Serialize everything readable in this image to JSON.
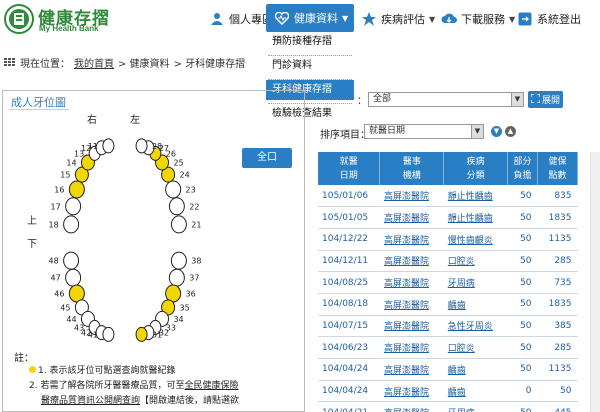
{
  "site": {
    "title": "健康存摺",
    "subtitle": "My Health Bank",
    "logo_ring_text": "衛生福利部中央健康保險署",
    "brand_color": "#2f8a3a"
  },
  "nav": {
    "personal": "個人專區",
    "health": "健康資料",
    "disease": "疾病評估",
    "download": "下載服務",
    "logout": "系統登出"
  },
  "dropdown": {
    "items": [
      {
        "label": "預防接種存摺",
        "active": false
      },
      {
        "label": "門診資料",
        "active": false
      },
      {
        "label": "牙科健康存摺",
        "active": true
      },
      {
        "label": "檢驗檢查結果",
        "active": false
      }
    ]
  },
  "breadcrumb": {
    "prefix": "現在位置：",
    "home": "我的首頁",
    "sep1": "> 健康資料",
    "sep2": "> 牙科健康存摺"
  },
  "panel": {
    "title": "成人牙位圖",
    "right": "右",
    "left": "左",
    "upper": "上",
    "lower": "下",
    "all_button": "全口",
    "notes_label": "註：",
    "note1": "1. 表示該牙位可點選查詢就醫紀錄",
    "note2_prefix": "2. 若需了解各院所牙醫醫療品質，可至",
    "note2_link": "全民健康保險",
    "note3_link": "醫療品質資訊公開網查詢",
    "note3_suffix": "【開啟連結後，請點選欲",
    "highlight_color": "#f2d600"
  },
  "teeth": {
    "upper_right": [
      "18",
      "17",
      "16",
      "15",
      "14",
      "13",
      "12",
      "11"
    ],
    "upper_left": [
      "21",
      "22",
      "23",
      "24",
      "25",
      "26",
      "27",
      "28"
    ],
    "lower_left": [
      "38",
      "37",
      "36",
      "35",
      "34",
      "33",
      "32",
      "31"
    ],
    "lower_right": [
      "48",
      "47",
      "46",
      "45",
      "44",
      "43",
      "42",
      "41"
    ],
    "highlighted": [
      "16",
      "15",
      "14",
      "24",
      "25",
      "26",
      "46",
      "36",
      "35",
      "31"
    ]
  },
  "filter": {
    "colon": "：",
    "value": "全部",
    "expand_label": "展開"
  },
  "sort": {
    "label": "排序項目：",
    "value": "就醫日期"
  },
  "table": {
    "headers": [
      [
        "就醫",
        "日期"
      ],
      [
        "醫事",
        "機構"
      ],
      [
        "疾病",
        "分類"
      ],
      [
        "部分",
        "負擔"
      ],
      [
        "健保",
        "點數"
      ]
    ],
    "rows": [
      {
        "date": "105/01/06",
        "inst": "高屏澎醫院",
        "dx": "靜止性齲齒",
        "copay": "50",
        "points": "835"
      },
      {
        "date": "105/01/05",
        "inst": "高屏澎醫院",
        "dx": "靜止性齲齒",
        "copay": "50",
        "points": "1835"
      },
      {
        "date": "104/12/22",
        "inst": "高屏澎醫院",
        "dx": "慢性齒齦炎",
        "copay": "50",
        "points": "1135"
      },
      {
        "date": "104/12/11",
        "inst": "高屏澎醫院",
        "dx": "口腔炎",
        "copay": "50",
        "points": "285"
      },
      {
        "date": "104/08/25",
        "inst": "高屏澎醫院",
        "dx": "牙周病",
        "copay": "50",
        "points": "735"
      },
      {
        "date": "104/08/18",
        "inst": "高屏澎醫院",
        "dx": "齲齒",
        "copay": "50",
        "points": "1835"
      },
      {
        "date": "104/07/15",
        "inst": "高屏澎醫院",
        "dx": "急性牙周炎",
        "copay": "50",
        "points": "385"
      },
      {
        "date": "104/06/23",
        "inst": "高屏澎醫院",
        "dx": "口腔炎",
        "copay": "50",
        "points": "285"
      },
      {
        "date": "104/04/24",
        "inst": "高屏澎醫院",
        "dx": "齲齒",
        "copay": "50",
        "points": "1135"
      },
      {
        "date": "104/04/24",
        "inst": "高屏澎醫院",
        "dx": "齲齒",
        "copay": "0",
        "points": "50"
      },
      {
        "date": "104/04/21",
        "inst": "高屏澎醫院",
        "dx": "牙周病",
        "copay": "50",
        "points": "445"
      }
    ]
  },
  "colors": {
    "accent": "#2a7fc4",
    "link": "#1f5fa0"
  }
}
